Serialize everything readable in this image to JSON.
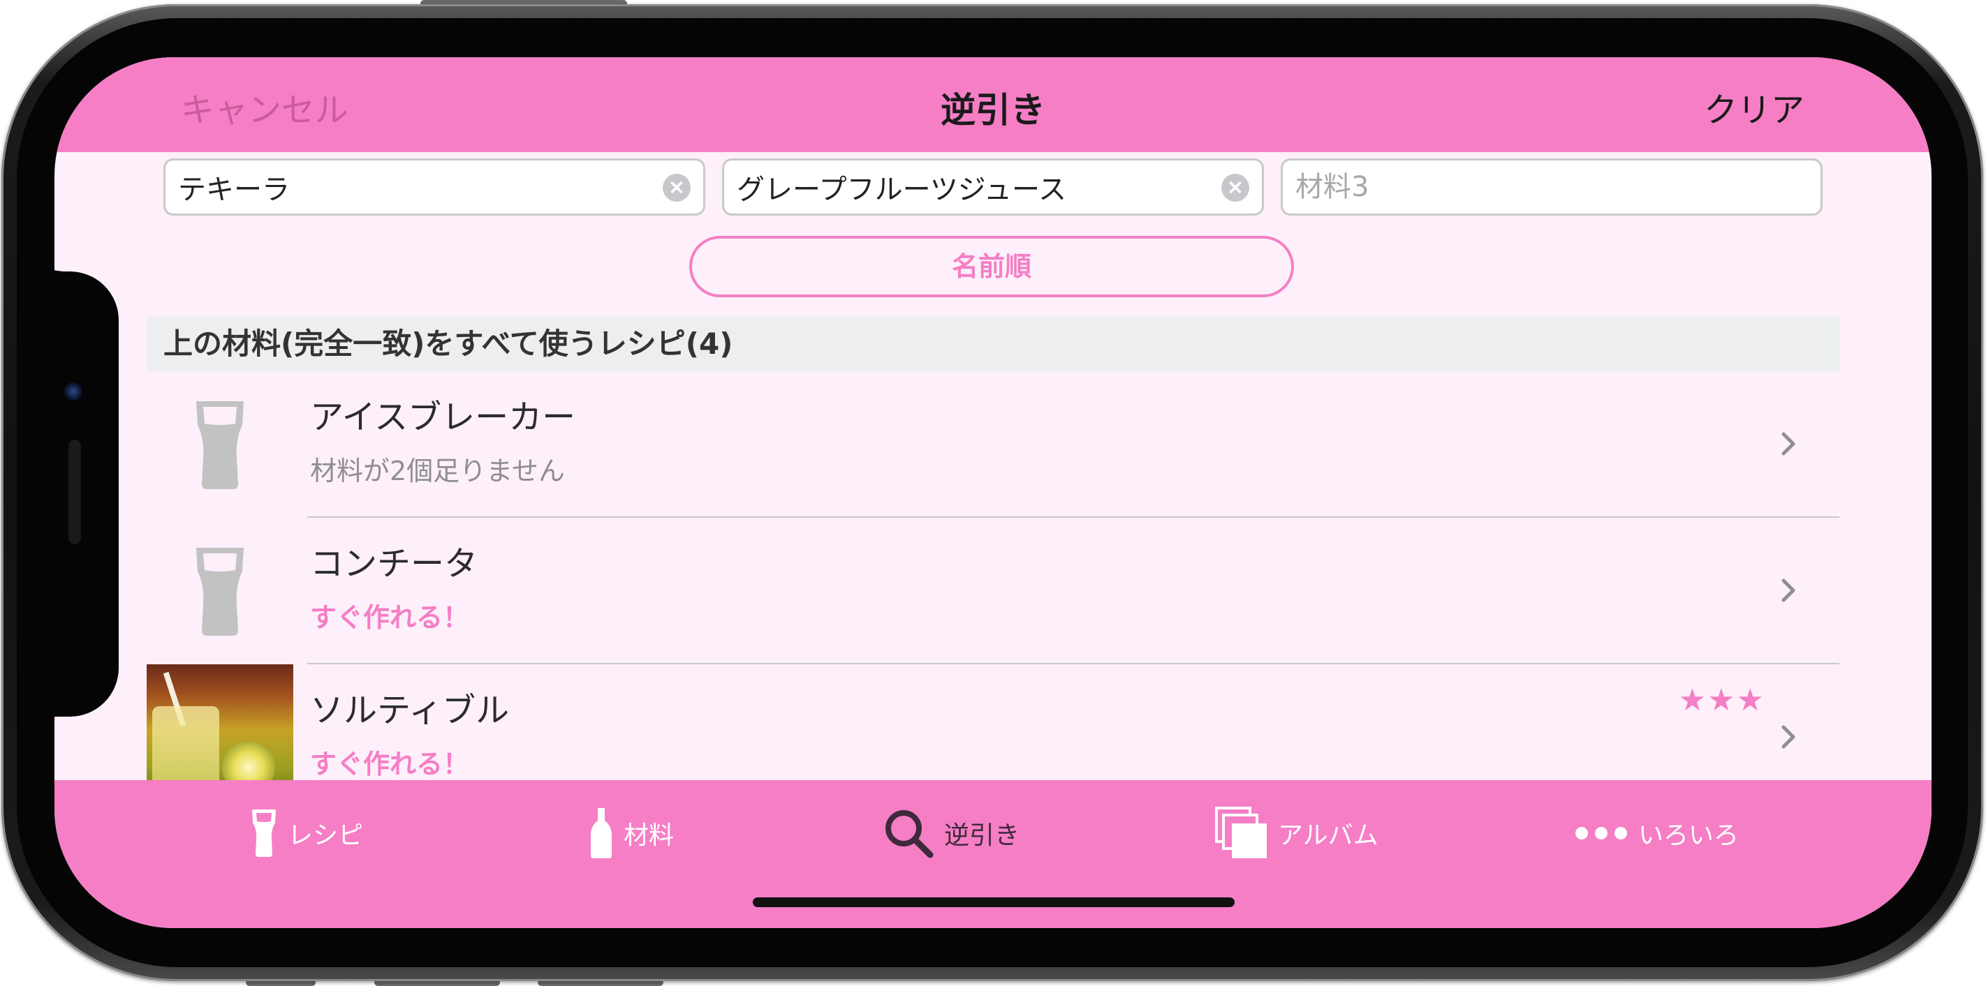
{
  "nav": {
    "cancel_label": "キャンセル",
    "title": "逆引き",
    "clear_label": "クリア"
  },
  "search": {
    "fields": [
      {
        "value": "テキーラ",
        "placeholder": "材料1"
      },
      {
        "value": "グレープフルーツジュース",
        "placeholder": "材料2"
      },
      {
        "value": "",
        "placeholder": "材料3"
      }
    ]
  },
  "sort": {
    "label": "名前順"
  },
  "section": {
    "header": "上の材料(完全一致)をすべて使うレシピ(4)"
  },
  "recipes": [
    {
      "name": "アイスブレーカー",
      "status": "材料が2個足りません",
      "ready": false,
      "stars": ""
    },
    {
      "name": "コンチータ",
      "status": "すぐ作れる！",
      "ready": true,
      "stars": ""
    },
    {
      "name": "ソルティブル",
      "status": "すぐ作れる！",
      "ready": true,
      "stars": "★★★",
      "rating": 3
    }
  ],
  "tabs": [
    {
      "label": "レシピ",
      "icon": "glass-icon",
      "active": false
    },
    {
      "label": "材料",
      "icon": "bottle-icon",
      "active": false
    },
    {
      "label": "逆引き",
      "icon": "search-icon",
      "active": true
    },
    {
      "label": "アルバム",
      "icon": "album-icon",
      "active": false
    },
    {
      "label": "いろいろ",
      "icon": "more-icon",
      "active": false
    }
  ],
  "colors": {
    "accent": "#f57ec5",
    "background": "#fdf0fb",
    "section_header_bg": "#eceef0",
    "active_tab": "#3d2a3a"
  }
}
